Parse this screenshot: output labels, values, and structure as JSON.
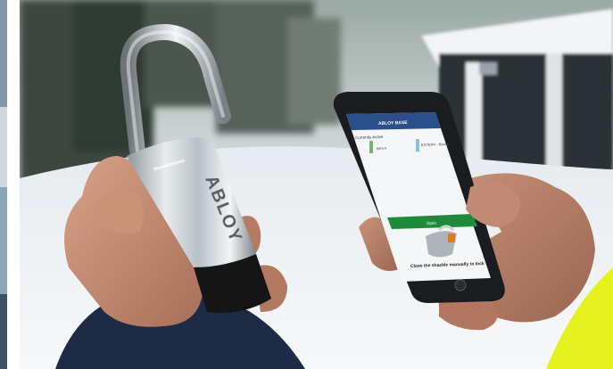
{
  "photo": {
    "lock_brand": "ABLOY",
    "app": {
      "header_title": "ABLOY BASE",
      "section_label": "Currently Active",
      "item_left": "Item A",
      "item_right": "EXTERN - Bound",
      "status_bar_label": "Open",
      "instruction": "Close the shackle manually to lock"
    },
    "colors": {
      "app_header": "#2a4f8a",
      "status_bar": "#1f8a3a",
      "lock_body": "#c9cfd4",
      "lock_bottom": "#151515",
      "jacket_dark": "#1d2b45",
      "jacket_yellow": "#e6f21e",
      "skin": "#c99378"
    }
  }
}
